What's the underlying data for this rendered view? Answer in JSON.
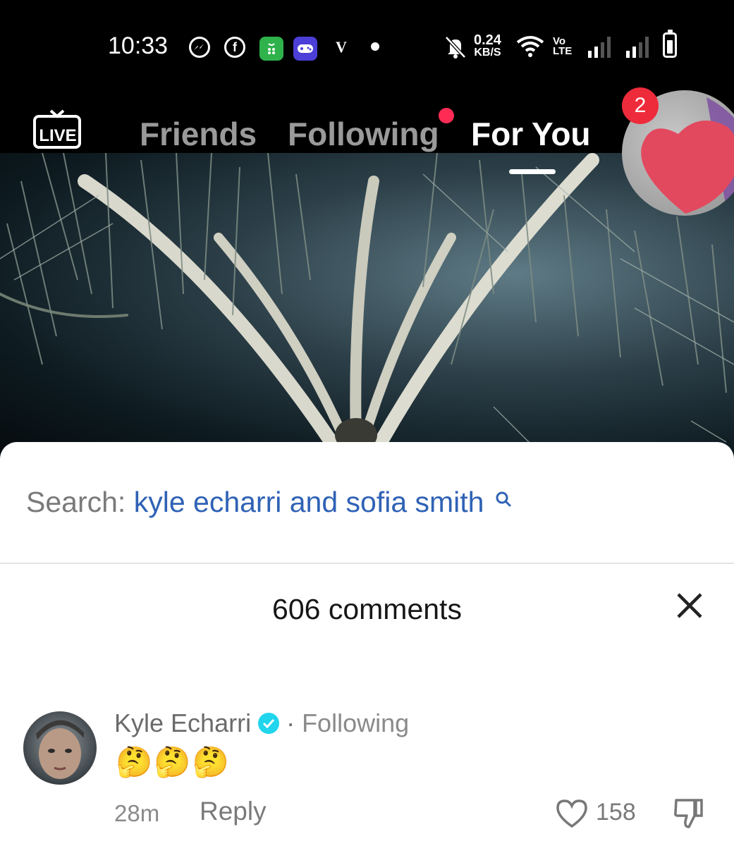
{
  "status_bar": {
    "time": "10:33",
    "notification_icons": [
      "messenger-icon",
      "facebook-icon",
      "green-app-icon",
      "game-app-icon",
      "v-icon",
      "dot-icon"
    ],
    "v_label": "V",
    "net_speed_value": "0.24",
    "net_speed_unit": "KB/S",
    "volte_top": "Vo",
    "volte_bottom": "LTE",
    "right_icons": [
      "mute-bell-icon",
      "wifi-icon",
      "signal-icon",
      "signal-x-icon",
      "battery-icon"
    ]
  },
  "nav": {
    "live_label": "LIVE",
    "tabs": [
      "Friends",
      "Following",
      "For You"
    ],
    "active_tab": "For You",
    "notification_badge": "2"
  },
  "sheet": {
    "search_prefix": "Search:",
    "search_query": "kyle echarri and sofia smith",
    "comments_title": "606 comments",
    "comment": {
      "username": "Kyle Echarri",
      "dot": "·",
      "relation": "Following",
      "text": "🤔🤔🤔",
      "time": "28m",
      "reply_label": "Reply",
      "likes": "158"
    }
  },
  "colors": {
    "accent_red": "#fe2c55",
    "search_blue": "#2f62b5",
    "badge_red": "#ee2b3b",
    "verified_cyan": "#20d5ec"
  }
}
